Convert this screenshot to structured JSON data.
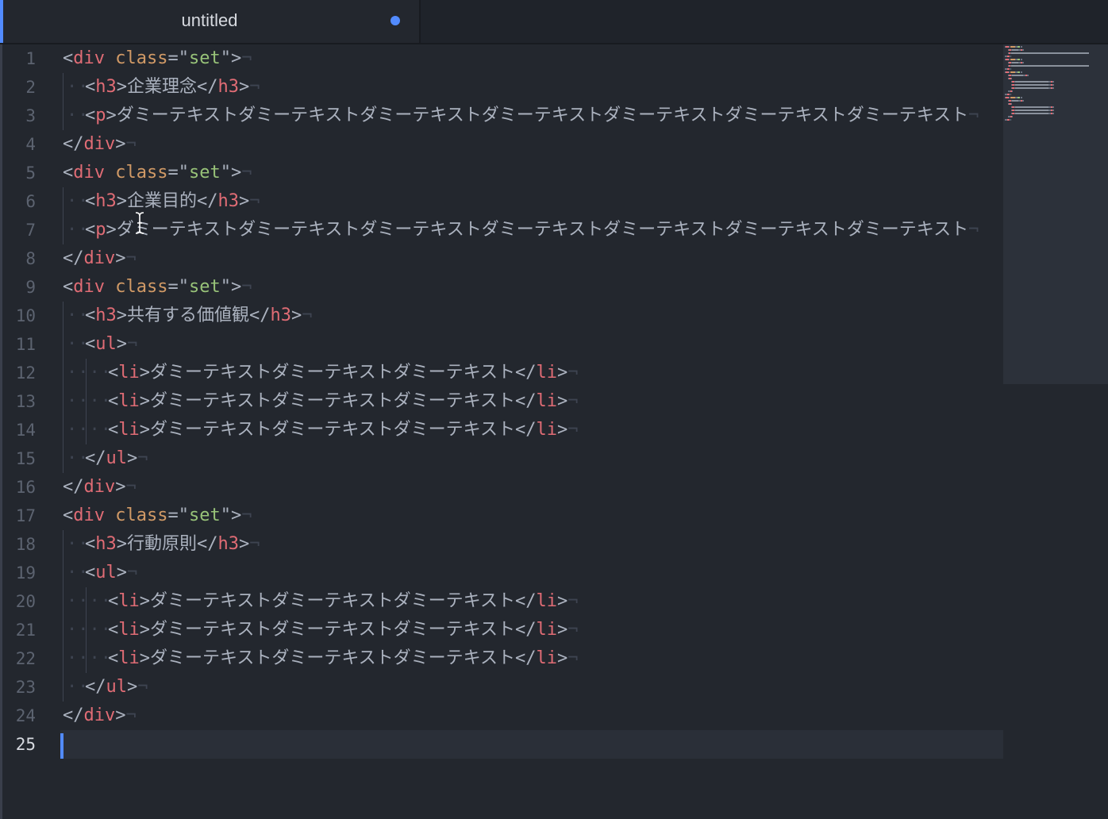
{
  "tab": {
    "title": "untitled",
    "modified": true
  },
  "colors": {
    "background": "#23272e",
    "accent": "#528bff",
    "tag": "#e06c75",
    "attribute": "#d19a66",
    "string": "#98c379",
    "text": "#abb2bf",
    "line_number": "#5c6370"
  },
  "editor": {
    "current_line": 25,
    "line_numbers": [
      "1",
      "2",
      "3",
      "4",
      "5",
      "6",
      "7",
      "8",
      "9",
      "10",
      "11",
      "12",
      "13",
      "14",
      "15",
      "16",
      "17",
      "18",
      "19",
      "20",
      "21",
      "22",
      "23",
      "24",
      "25"
    ],
    "lines": [
      {
        "indent": 0,
        "tokens": [
          [
            "punct",
            "<"
          ],
          [
            "tag",
            "div"
          ],
          [
            "punct",
            " "
          ],
          [
            "attr",
            "class"
          ],
          [
            "punct",
            "=\""
          ],
          [
            "str",
            "set"
          ],
          [
            "punct",
            "\">"
          ]
        ]
      },
      {
        "indent": 1,
        "tokens": [
          [
            "punct",
            "<"
          ],
          [
            "tag",
            "h3"
          ],
          [
            "punct",
            ">"
          ],
          [
            "text",
            "企業理念"
          ],
          [
            "punct",
            "</"
          ],
          [
            "tag",
            "h3"
          ],
          [
            "punct",
            ">"
          ]
        ]
      },
      {
        "indent": 1,
        "tokens": [
          [
            "punct",
            "<"
          ],
          [
            "tag",
            "p"
          ],
          [
            "punct",
            ">"
          ],
          [
            "text",
            "ダミーテキストダミーテキストダミーテキストダミーテキストダミーテキストダミーテキストダミーテキスト"
          ]
        ]
      },
      {
        "indent": 0,
        "tokens": [
          [
            "punct",
            "</"
          ],
          [
            "tag",
            "div"
          ],
          [
            "punct",
            ">"
          ]
        ]
      },
      {
        "indent": 0,
        "tokens": [
          [
            "punct",
            "<"
          ],
          [
            "tag",
            "div"
          ],
          [
            "punct",
            " "
          ],
          [
            "attr",
            "class"
          ],
          [
            "punct",
            "=\""
          ],
          [
            "str",
            "set"
          ],
          [
            "punct",
            "\">"
          ]
        ]
      },
      {
        "indent": 1,
        "tokens": [
          [
            "punct",
            "<"
          ],
          [
            "tag",
            "h3"
          ],
          [
            "punct",
            ">"
          ],
          [
            "text",
            "企業目的"
          ],
          [
            "punct",
            "</"
          ],
          [
            "tag",
            "h3"
          ],
          [
            "punct",
            ">"
          ]
        ]
      },
      {
        "indent": 1,
        "tokens": [
          [
            "punct",
            "<"
          ],
          [
            "tag",
            "p"
          ],
          [
            "punct",
            ">"
          ],
          [
            "text",
            "ダミーテキストダミーテキストダミーテキストダミーテキストダミーテキストダミーテキストダミーテキスト"
          ]
        ]
      },
      {
        "indent": 0,
        "tokens": [
          [
            "punct",
            "</"
          ],
          [
            "tag",
            "div"
          ],
          [
            "punct",
            ">"
          ]
        ]
      },
      {
        "indent": 0,
        "tokens": [
          [
            "punct",
            "<"
          ],
          [
            "tag",
            "div"
          ],
          [
            "punct",
            " "
          ],
          [
            "attr",
            "class"
          ],
          [
            "punct",
            "=\""
          ],
          [
            "str",
            "set"
          ],
          [
            "punct",
            "\">"
          ]
        ]
      },
      {
        "indent": 1,
        "tokens": [
          [
            "punct",
            "<"
          ],
          [
            "tag",
            "h3"
          ],
          [
            "punct",
            ">"
          ],
          [
            "text",
            "共有する価値観"
          ],
          [
            "punct",
            "</"
          ],
          [
            "tag",
            "h3"
          ],
          [
            "punct",
            ">"
          ]
        ]
      },
      {
        "indent": 1,
        "tokens": [
          [
            "punct",
            "<"
          ],
          [
            "tag",
            "ul"
          ],
          [
            "punct",
            ">"
          ]
        ]
      },
      {
        "indent": 2,
        "tokens": [
          [
            "punct",
            "<"
          ],
          [
            "tag",
            "li"
          ],
          [
            "punct",
            ">"
          ],
          [
            "text",
            "ダミーテキストダミーテキストダミーテキスト"
          ],
          [
            "punct",
            "</"
          ],
          [
            "tag",
            "li"
          ],
          [
            "punct",
            ">"
          ]
        ]
      },
      {
        "indent": 2,
        "tokens": [
          [
            "punct",
            "<"
          ],
          [
            "tag",
            "li"
          ],
          [
            "punct",
            ">"
          ],
          [
            "text",
            "ダミーテキストダミーテキストダミーテキスト"
          ],
          [
            "punct",
            "</"
          ],
          [
            "tag",
            "li"
          ],
          [
            "punct",
            ">"
          ]
        ]
      },
      {
        "indent": 2,
        "tokens": [
          [
            "punct",
            "<"
          ],
          [
            "tag",
            "li"
          ],
          [
            "punct",
            ">"
          ],
          [
            "text",
            "ダミーテキストダミーテキストダミーテキスト"
          ],
          [
            "punct",
            "</"
          ],
          [
            "tag",
            "li"
          ],
          [
            "punct",
            ">"
          ]
        ]
      },
      {
        "indent": 1,
        "tokens": [
          [
            "punct",
            "</"
          ],
          [
            "tag",
            "ul"
          ],
          [
            "punct",
            ">"
          ]
        ]
      },
      {
        "indent": 0,
        "tokens": [
          [
            "punct",
            "</"
          ],
          [
            "tag",
            "div"
          ],
          [
            "punct",
            ">"
          ]
        ]
      },
      {
        "indent": 0,
        "tokens": [
          [
            "punct",
            "<"
          ],
          [
            "tag",
            "div"
          ],
          [
            "punct",
            " "
          ],
          [
            "attr",
            "class"
          ],
          [
            "punct",
            "=\""
          ],
          [
            "str",
            "set"
          ],
          [
            "punct",
            "\">"
          ]
        ]
      },
      {
        "indent": 1,
        "tokens": [
          [
            "punct",
            "<"
          ],
          [
            "tag",
            "h3"
          ],
          [
            "punct",
            ">"
          ],
          [
            "text",
            "行動原則"
          ],
          [
            "punct",
            "</"
          ],
          [
            "tag",
            "h3"
          ],
          [
            "punct",
            ">"
          ]
        ]
      },
      {
        "indent": 1,
        "tokens": [
          [
            "punct",
            "<"
          ],
          [
            "tag",
            "ul"
          ],
          [
            "punct",
            ">"
          ]
        ]
      },
      {
        "indent": 2,
        "tokens": [
          [
            "punct",
            "<"
          ],
          [
            "tag",
            "li"
          ],
          [
            "punct",
            ">"
          ],
          [
            "text",
            "ダミーテキストダミーテキストダミーテキスト"
          ],
          [
            "punct",
            "</"
          ],
          [
            "tag",
            "li"
          ],
          [
            "punct",
            ">"
          ]
        ]
      },
      {
        "indent": 2,
        "tokens": [
          [
            "punct",
            "<"
          ],
          [
            "tag",
            "li"
          ],
          [
            "punct",
            ">"
          ],
          [
            "text",
            "ダミーテキストダミーテキストダミーテキスト"
          ],
          [
            "punct",
            "</"
          ],
          [
            "tag",
            "li"
          ],
          [
            "punct",
            ">"
          ]
        ]
      },
      {
        "indent": 2,
        "tokens": [
          [
            "punct",
            "<"
          ],
          [
            "tag",
            "li"
          ],
          [
            "punct",
            ">"
          ],
          [
            "text",
            "ダミーテキストダミーテキストダミーテキスト"
          ],
          [
            "punct",
            "</"
          ],
          [
            "tag",
            "li"
          ],
          [
            "punct",
            ">"
          ]
        ]
      },
      {
        "indent": 1,
        "tokens": [
          [
            "punct",
            "</"
          ],
          [
            "tag",
            "ul"
          ],
          [
            "punct",
            ">"
          ]
        ]
      },
      {
        "indent": 0,
        "tokens": [
          [
            "punct",
            "</"
          ],
          [
            "tag",
            "div"
          ],
          [
            "punct",
            ">"
          ]
        ]
      },
      {
        "indent": 0,
        "tokens": []
      }
    ]
  }
}
